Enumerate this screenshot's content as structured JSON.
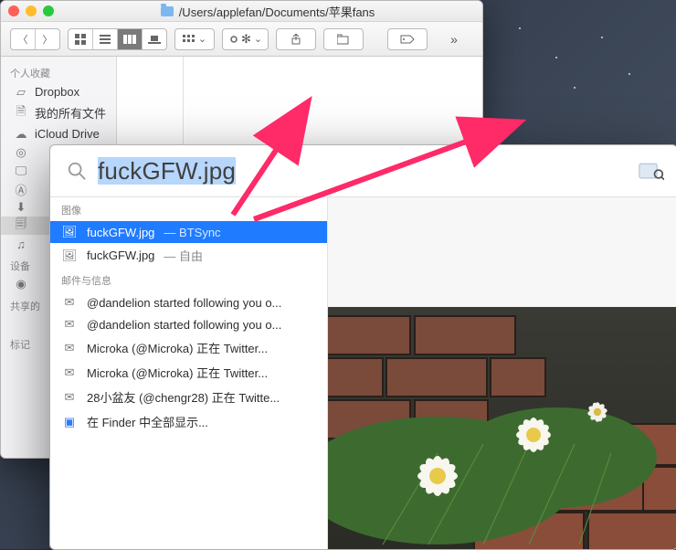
{
  "finder": {
    "title_path": "/Users/applefan/Documents/苹果fans",
    "sidebar": {
      "sections": [
        {
          "label": "个人收藏",
          "items": [
            {
              "icon": "dropbox-icon",
              "label": "Dropbox"
            },
            {
              "icon": "document-icon",
              "label": "我的所有文件"
            },
            {
              "icon": "cloud-icon",
              "label": "iCloud Drive"
            },
            {
              "icon": "airdrop-icon",
              "label": ""
            },
            {
              "icon": "desktop-icon",
              "label": ""
            },
            {
              "icon": "apps-icon",
              "label": ""
            },
            {
              "icon": "downloads-icon",
              "label": ""
            },
            {
              "icon": "documents-icon",
              "label": "",
              "selected": true
            },
            {
              "icon": "music-icon",
              "label": ""
            }
          ]
        },
        {
          "label": "设备",
          "items": [
            {
              "icon": "disc-icon",
              "label": ""
            }
          ]
        },
        {
          "label": "共享的",
          "items": []
        },
        {
          "label": "标记",
          "items": []
        }
      ]
    }
  },
  "spotlight": {
    "query": "fuckGFW.jpg",
    "trailing_icon": "preview-app-icon",
    "categories": [
      {
        "label": "图像",
        "items": [
          {
            "icon": "image-file-icon",
            "text": "fuckGFW.jpg",
            "hint": " — BTSync",
            "selected": true
          },
          {
            "icon": "image-file-icon",
            "text": "fuckGFW.jpg",
            "hint": " — 自由"
          }
        ]
      },
      {
        "label": "邮件与信息",
        "items": [
          {
            "icon": "mail-icon",
            "text": "@dandelion started following you o..."
          },
          {
            "icon": "mail-icon",
            "text": "@dandelion started following you o..."
          },
          {
            "icon": "mail-icon",
            "text": "Microka (@Microka) 正在 Twitter..."
          },
          {
            "icon": "mail-icon",
            "text": "Microka (@Microka) 正在 Twitter..."
          },
          {
            "icon": "mail-icon",
            "text": "28小盆友 (@chengr28) 正在 Twitte..."
          },
          {
            "icon": "finder-icon",
            "text": "在 Finder 中全部显示..."
          }
        ]
      }
    ]
  },
  "colors": {
    "accent": "#1f7bff",
    "arrow": "#ff2a68"
  }
}
